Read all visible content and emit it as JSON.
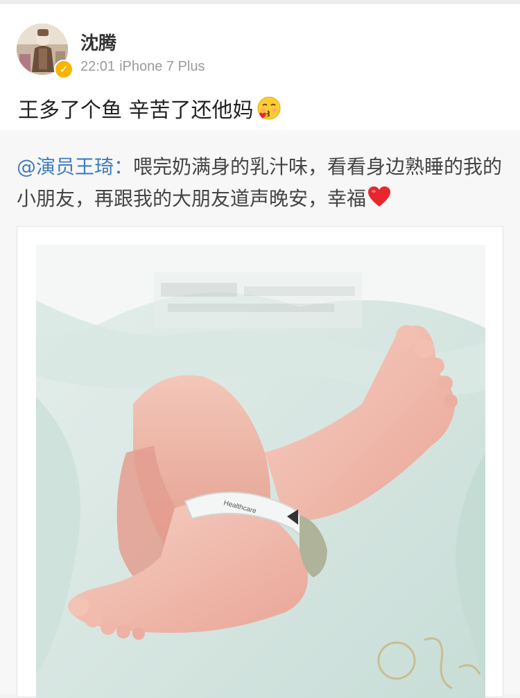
{
  "post": {
    "username": "沈腾",
    "time": "22:01",
    "device": "iPhone 7 Plus",
    "text": "王多了个鱼 辛苦了还他妈",
    "emoji": "kissing-face-icon",
    "verified_icon": "verified-badge-icon"
  },
  "repost": {
    "mention": "@演员王琦",
    "separator": "：",
    "text": "喂完奶满身的乳汁味，看看身边熟睡的我的小朋友，再跟我的大朋友道声晚安，幸福",
    "emoji": "red-heart-icon"
  },
  "photo": {
    "wristband_text": "Healthcare",
    "description_icon": "baby-feet-photo"
  },
  "colors": {
    "mention": "#3f7cbf",
    "verified": "#f7b500",
    "heart": "#e8262e"
  }
}
